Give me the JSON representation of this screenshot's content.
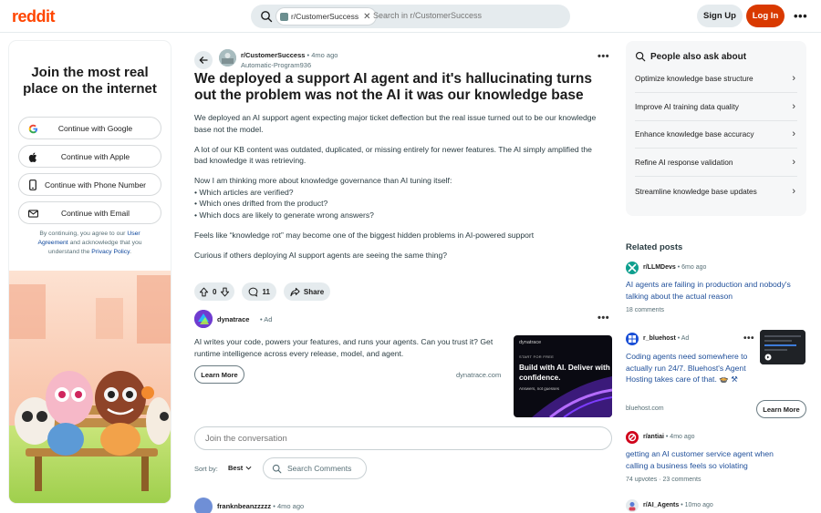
{
  "header": {
    "logo": "reddit",
    "search_chip": "r/CustomerSuccess",
    "search_placeholder": "Search in r/CustomerSuccess",
    "signup_label": "Sign Up",
    "login_label": "Log In",
    "more_label": "•••",
    "brand_color": "#ff4500",
    "login_color": "#d93900"
  },
  "promo": {
    "title": "Join the most real place on the internet",
    "buttons": [
      {
        "label": "Continue with Google",
        "icon": "google-icon"
      },
      {
        "label": "Continue with Apple",
        "icon": "apple-icon"
      },
      {
        "label": "Continue with Phone Number",
        "icon": "phone-icon"
      },
      {
        "label": "Continue with Email",
        "icon": "email-icon"
      }
    ],
    "terms_pre": "By continuing, you agree to our ",
    "terms_link": "User Agreement",
    "terms_mid": " and acknowledge that you understand the ",
    "privacy_link": "Privacy Policy",
    "terms_post": "."
  },
  "post": {
    "subreddit": "r/CustomerSuccess",
    "age": "• 4mo ago",
    "author": "Automatic-Program936",
    "more_label": "•••",
    "title": "We deployed a support AI agent and it's hallucinating turns out the problem was not the AI it was our knowledge base",
    "body": [
      "We deployed an AI support agent expecting major ticket deflection but the real issue turned out to be our knowledge base not the model.",
      "A lot of our KB content was outdated, duplicated, or missing entirely for newer features. The AI simply amplified the bad knowledge it was retrieving.",
      "Now I am thinking more about knowledge governance than AI tuning itself:",
      "• Which articles are verified?",
      "• Which ones drifted from the product?",
      "• Which docs are likely to generate wrong answers?",
      "Feels like “knowledge rot” may become one of the biggest hidden problems in AI-powered support",
      "Curious if others deploying AI support agents are seeing the same thing?"
    ],
    "votes": "0",
    "comments": "11",
    "share_label": "Share"
  },
  "ad": {
    "name": "dynatrace",
    "tag": "• Ad",
    "more_label": "•••",
    "text": "AI writes your code, powers your features, and runs your agents. Can you trust it? Get runtime intelligence across every release, model, and agent.",
    "learn_label": "Learn More",
    "domain": "dynatrace.com",
    "image_brand": "dynatrace",
    "image_small": "START FOR FREE",
    "image_headline": "Build with AI. Deliver with confidence.",
    "image_sub": "Answers, not guesses"
  },
  "comments": {
    "composer_placeholder": "Join the conversation",
    "sort_label": "Sort by:",
    "sort_value": "Best",
    "search_placeholder": "Search Comments",
    "first_user": "franknbeanzzzzz",
    "first_age": "• 4mo ago"
  },
  "ask": {
    "title": "People also ask about",
    "items": [
      "Optimize knowledge base structure",
      "Improve AI training data quality",
      "Enhance knowledge base accuracy",
      "Refine AI response validation",
      "Streamline knowledge base updates"
    ]
  },
  "related": {
    "title": "Related posts",
    "posts": [
      {
        "sub": "r/LLMDevs",
        "age": "• 6mo ago",
        "title": "AI agents are failing in production and nobody's talking about the actual reason",
        "meta": "18 comments"
      },
      {
        "sub": "r_bluehost",
        "age": "• Ad",
        "title": "Coding agents need somewhere to actually run 24/7. Bluehost's Agent Hosting takes care of that. 🍲 ⚒",
        "meta": "bluehost.com",
        "learn_label": "Learn More",
        "more_label": "•••"
      },
      {
        "sub": "r/antiai",
        "age": "• 4mo ago",
        "title": "getting an AI customer service agent when calling a business feels so violating",
        "meta": "74 upvotes · 23 comments"
      },
      {
        "sub": "r/AI_Agents",
        "age": "• 10mo ago"
      }
    ]
  }
}
